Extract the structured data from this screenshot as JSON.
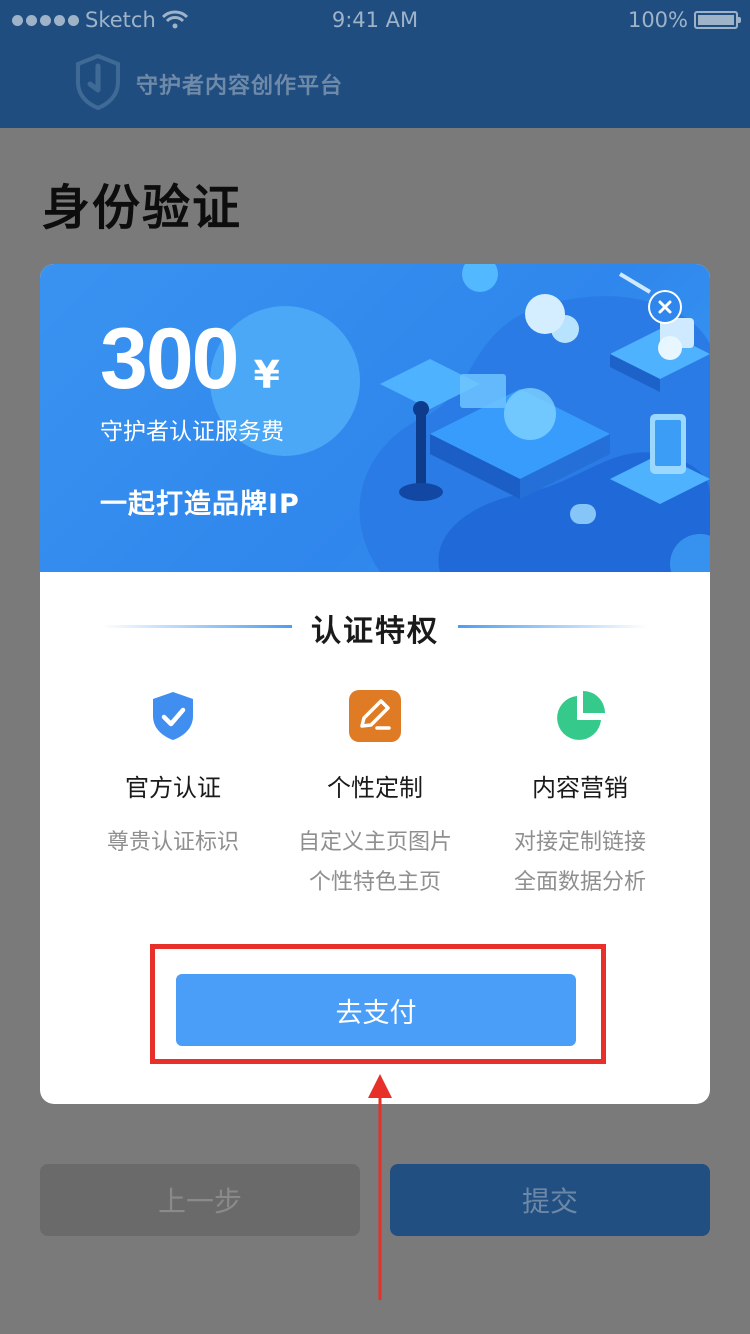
{
  "status_bar": {
    "carrier": "Sketch",
    "time": "9:41 AM",
    "battery": "100%",
    "icons": [
      "signal-dots-icon",
      "wifi-icon",
      "battery-icon"
    ]
  },
  "header": {
    "app_title": "守护者内容创作平台",
    "logo_icon": "shield-logo-icon"
  },
  "page": {
    "title": "身份验证"
  },
  "modal": {
    "banner": {
      "amount": "300",
      "currency": "¥",
      "fee_label": "守护者认证服务费",
      "slogan": "一起打造品牌IP",
      "close_icon": "close-icon"
    },
    "section_title": "认证特权",
    "features": [
      {
        "icon": "shield-check-icon",
        "title": "官方认证",
        "desc_line1": "尊贵认证标识",
        "desc_line2": "",
        "icon_color": "#3f8ef0"
      },
      {
        "icon": "edit-icon",
        "title": "个性定制",
        "desc_line1": "自定义主页图片",
        "desc_line2": "个性特色主页",
        "icon_color": "#e07b25"
      },
      {
        "icon": "pie-chart-icon",
        "title": "内容营销",
        "desc_line1": "对接定制链接",
        "desc_line2": "全面数据分析",
        "icon_color": "#35c98c"
      }
    ],
    "pay_button": "去支付"
  },
  "footer": {
    "prev_button": "上一步",
    "submit_button": "提交"
  },
  "colors": {
    "primary": "#4a9ef7",
    "header": "#1f4d80",
    "highlight": "#e8302a"
  }
}
